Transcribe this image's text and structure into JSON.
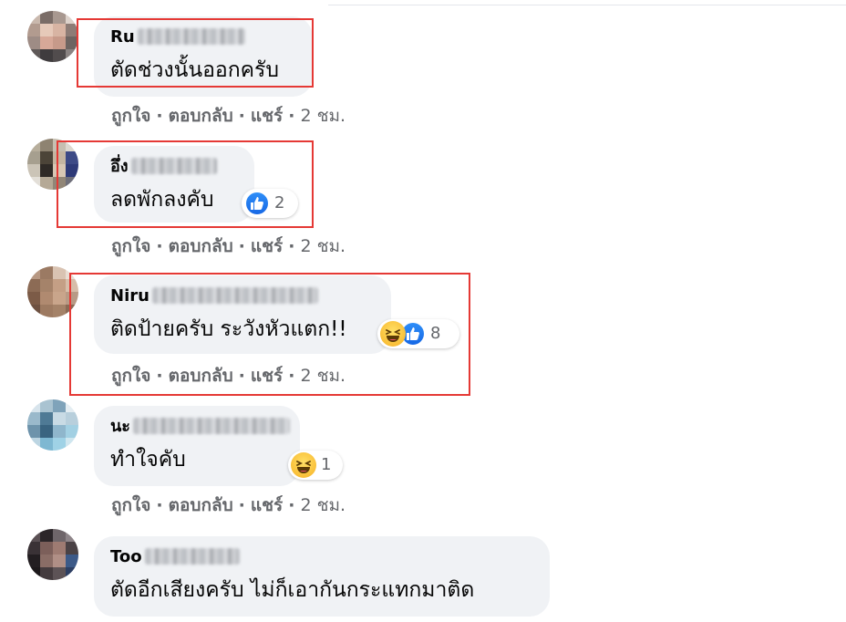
{
  "comments": [
    {
      "author_visible": "Ru",
      "text": "ตัดช่วงนั้นออกครับ",
      "reactions": null,
      "actions": {
        "like": "ถูกใจ",
        "reply": "ตอบกลับ",
        "share": "แชร์",
        "time": "2 ชม."
      }
    },
    {
      "author_visible": "อึ่ง",
      "text": "ลดพักลงคับ",
      "reactions": {
        "icons": [
          "like-icon"
        ],
        "count": "2"
      },
      "actions": {
        "like": "ถูกใจ",
        "reply": "ตอบกลับ",
        "share": "แชร์",
        "time": "2 ชม."
      }
    },
    {
      "author_visible": "Niru",
      "text": "ติดป้ายครับ ระวังหัวแตก!!",
      "reactions": {
        "icons": [
          "haha-icon",
          "like-icon"
        ],
        "count": "8"
      },
      "actions": {
        "like": "ถูกใจ",
        "reply": "ตอบกลับ",
        "share": "แชร์",
        "time": "2 ชม."
      }
    },
    {
      "author_visible": "นะ",
      "text": "ทำใจคับ",
      "reactions": {
        "icons": [
          "haha-icon"
        ],
        "count": "1"
      },
      "actions": {
        "like": "ถูกใจ",
        "reply": "ตอบกลับ",
        "share": "แชร์",
        "time": "2 ชม."
      }
    },
    {
      "author_visible": "Too",
      "text": "ตัดอีกเสียงครับ ไม่ก็เอากันกระแทกมาติด",
      "reactions": null,
      "actions": null
    }
  ],
  "colors": {
    "bubble": "#f0f2f5",
    "secondary_text": "#65676b",
    "like_blue": "#1877f2",
    "haha_yellow": "#f7b125",
    "highlight_red": "#e53935"
  }
}
